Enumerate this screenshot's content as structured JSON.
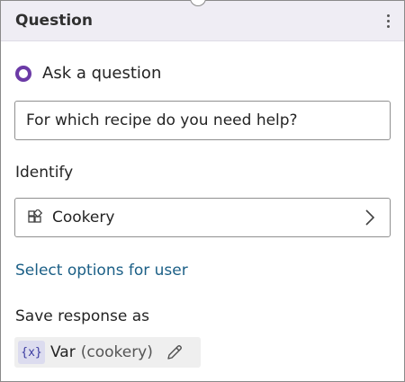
{
  "node": {
    "title": "Question",
    "menu_icon": "kebab-menu-icon"
  },
  "ask": {
    "label": "Ask a question",
    "icon": "question-node-dot-icon",
    "accent": "#6b3aa6",
    "question_text": "For which recipe do you need help?"
  },
  "identify": {
    "label": "Identify",
    "selected_value": "Cookery",
    "icon": "entity-grid-icon"
  },
  "options_link": "Select options for user",
  "save": {
    "label": "Save response as",
    "var_icon_text": "{x}",
    "var_name": "Var",
    "var_value": "(cookery)",
    "edit_icon": "pencil-icon"
  },
  "colors": {
    "header_bg": "#efedf4",
    "link": "#1b5f86"
  }
}
